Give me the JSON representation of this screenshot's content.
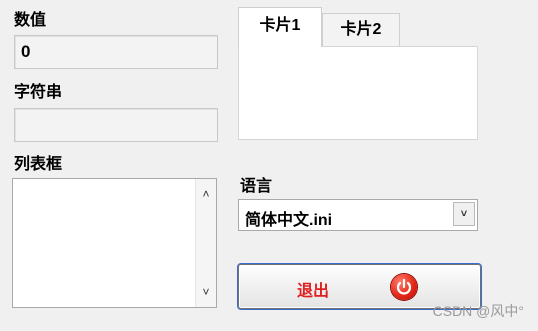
{
  "labels": {
    "numeric": "数值",
    "string": "字符串",
    "listbox": "列表框",
    "language": "语言"
  },
  "fields": {
    "numeric_value": "0",
    "string_value": ""
  },
  "tabs": [
    {
      "label": "卡片1",
      "active": true
    },
    {
      "label": "卡片2",
      "active": false
    }
  ],
  "language_select": {
    "selected": "简体中文.ini"
  },
  "exit_button": {
    "label": "退出"
  },
  "watermark": "CSDN @风中°"
}
